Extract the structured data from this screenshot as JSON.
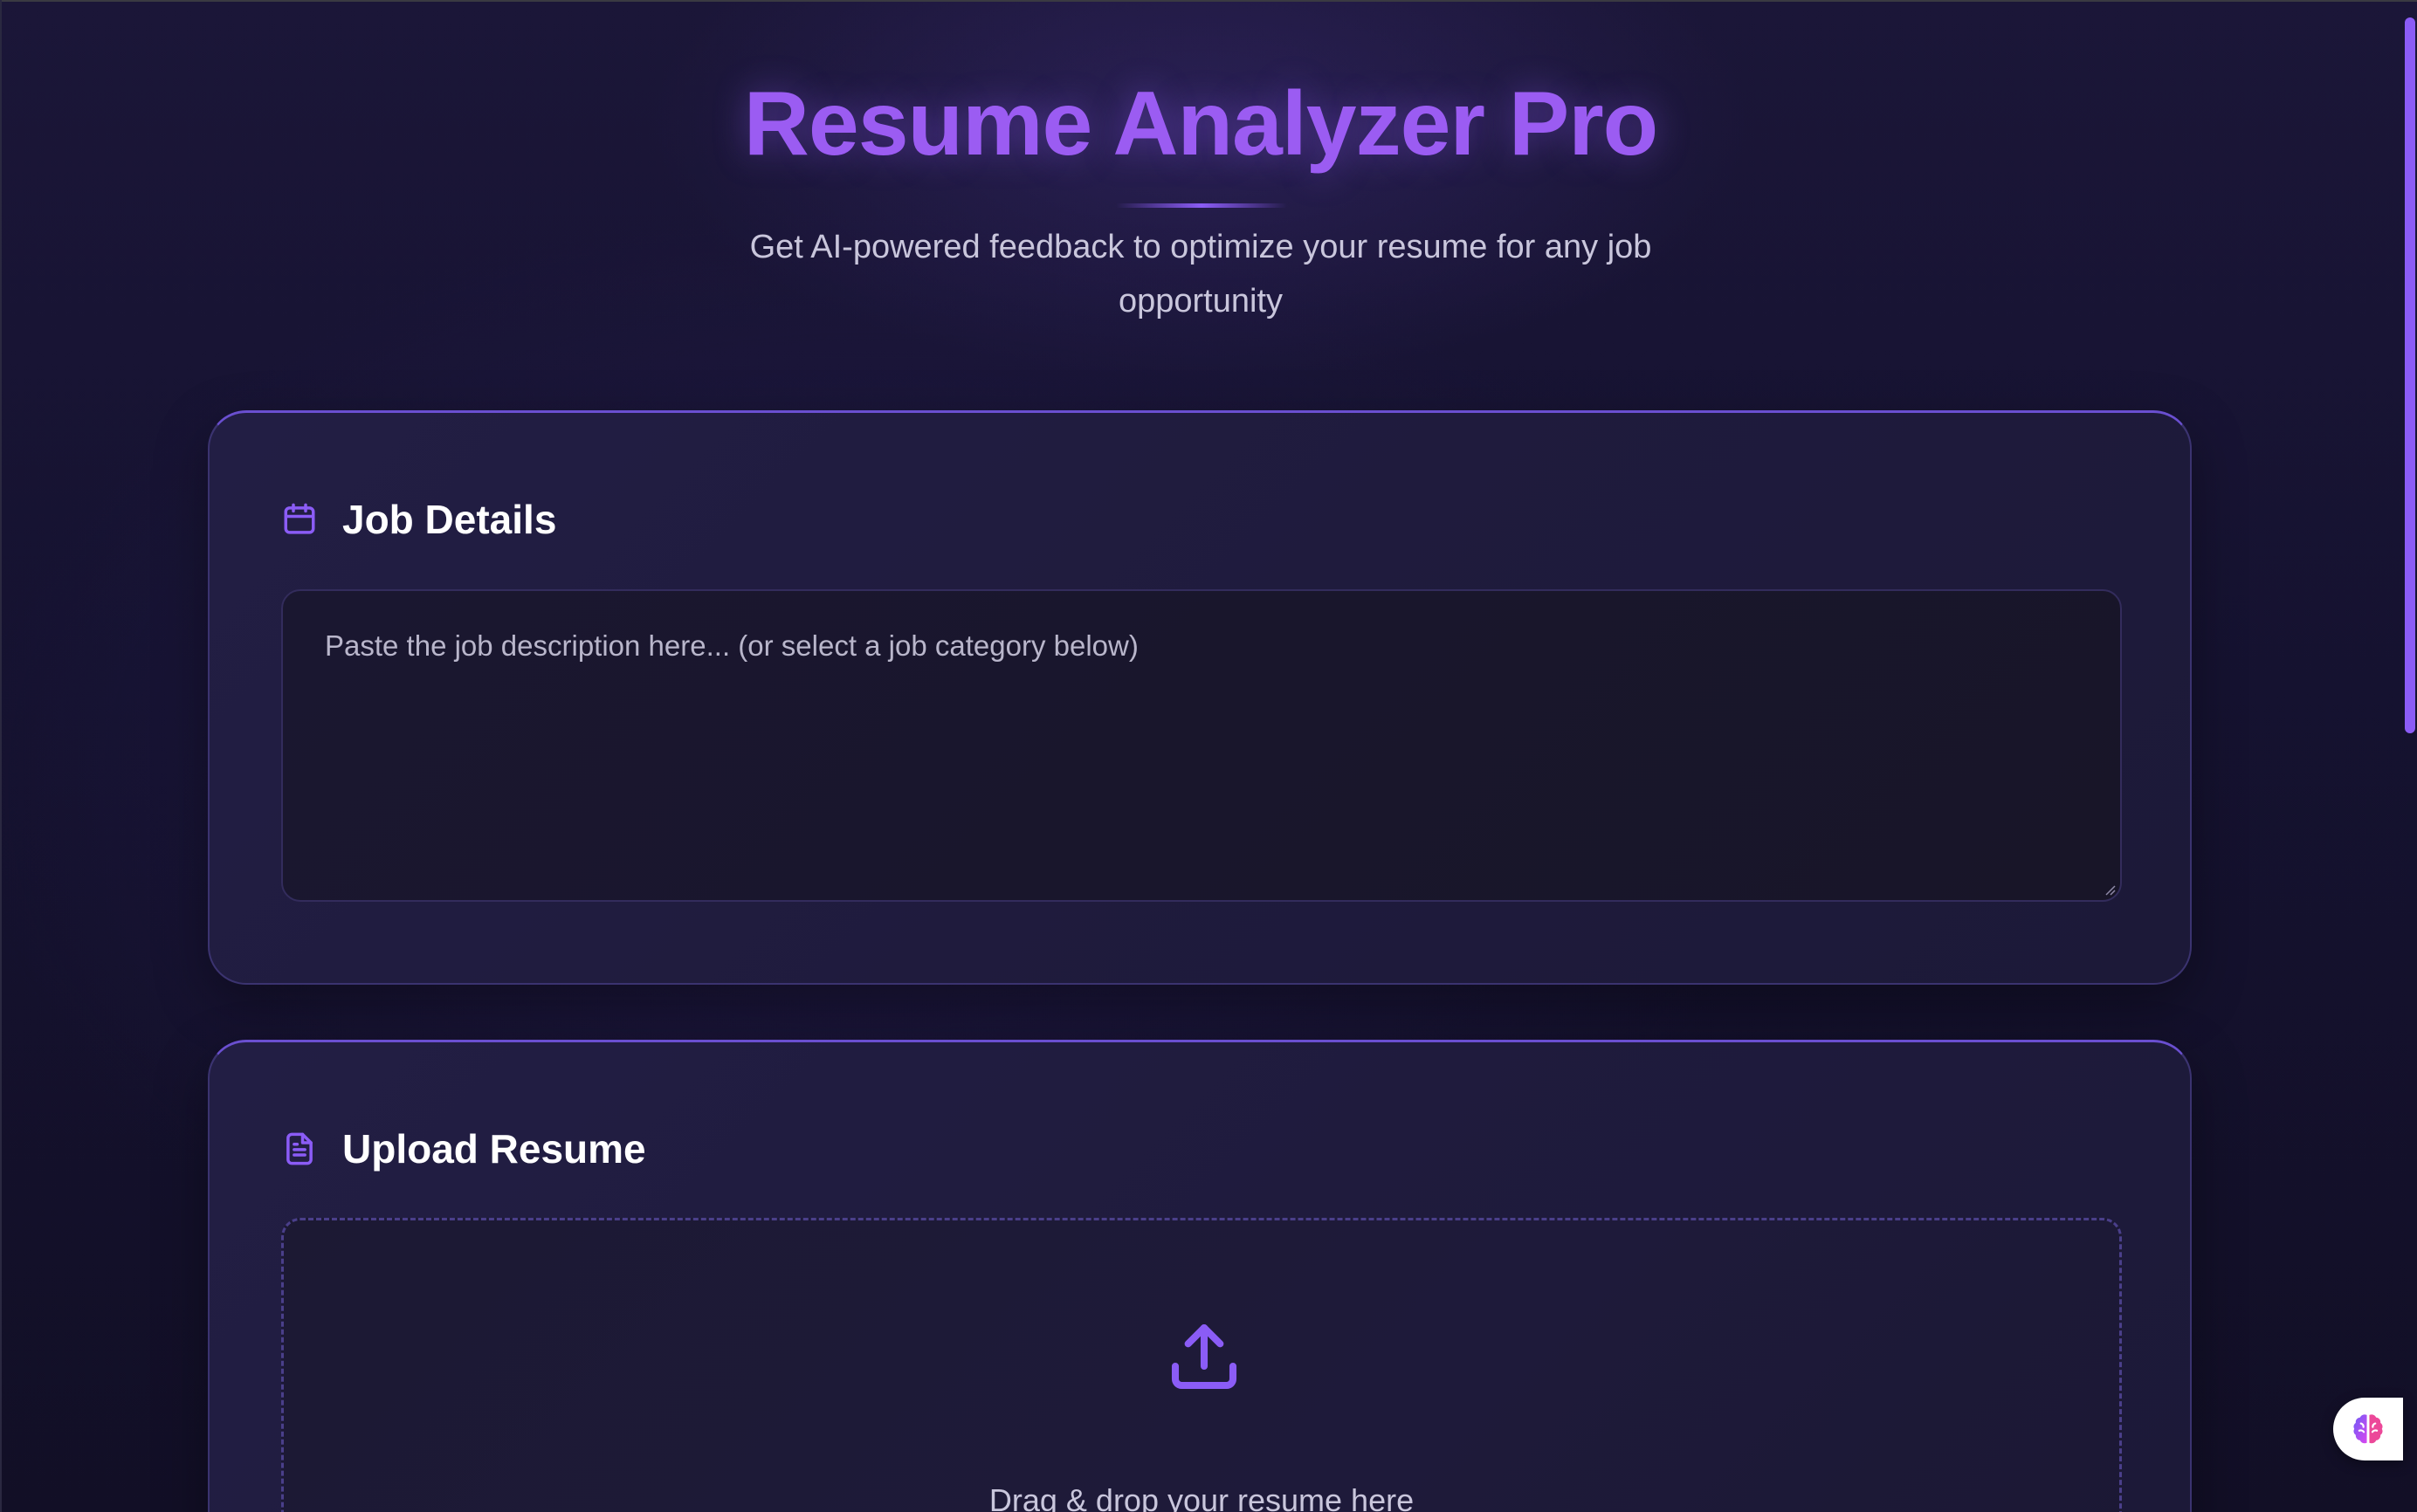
{
  "header": {
    "title": "Resume Analyzer Pro",
    "subtitle": "Get AI-powered feedback to optimize your resume for any job opportunity"
  },
  "job_details": {
    "title": "Job Details",
    "icon": "calendar-icon",
    "textarea_placeholder": "Paste the job description here... (or select a job category below)",
    "textarea_value": ""
  },
  "upload_resume": {
    "title": "Upload Resume",
    "icon": "document-icon",
    "upload_icon": "upload-icon",
    "dropzone_text": "Drag & drop your resume here"
  },
  "floating_button": {
    "icon": "brain-icon"
  },
  "colors": {
    "accent": "#8b5cf6",
    "title": "#9b5cf2",
    "background": "#151230",
    "card": "#221e44"
  }
}
